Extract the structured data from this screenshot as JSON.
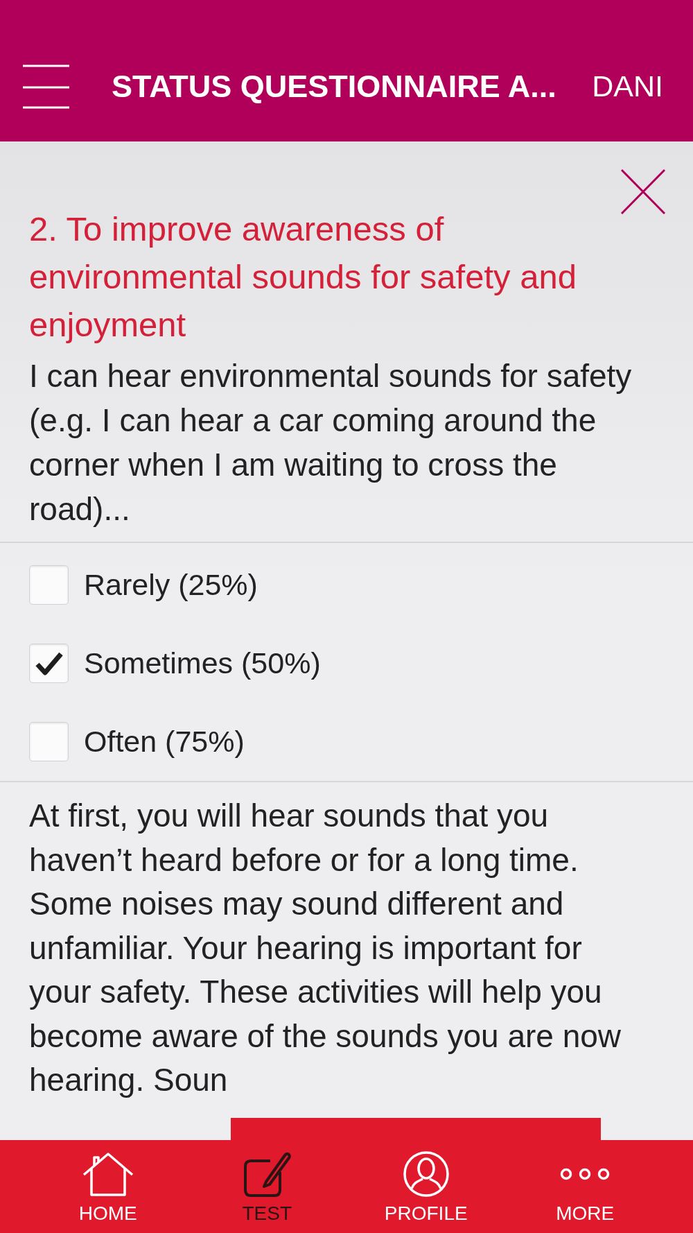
{
  "header": {
    "title": "STATUS QUESTIONNAIRE A...",
    "user": "DANI"
  },
  "question": {
    "heading": "2. To improve awareness of environmental sounds for safety and enjoyment",
    "prompt": "I can hear environmental sounds for safety (e.g. I can hear a car coming around the corner when I am waiting to cross the road)...",
    "options": [
      {
        "label": "Rarely (25%)",
        "checked": false
      },
      {
        "label": "Sometimes (50%)",
        "checked": true
      },
      {
        "label": "Often (75%)",
        "checked": false
      }
    ],
    "explanation": "At first, you will hear sounds that you haven’t heard before or for a long time. Some noises may sound different and unfamiliar. Your hearing is important for your safety. These activities will help you become aware of the sounds you are now hearing. Soun"
  },
  "bottom_nav": [
    {
      "label": "HOME",
      "selected": false
    },
    {
      "label": "TEST",
      "selected": true
    },
    {
      "label": "PROFILE",
      "selected": false
    },
    {
      "label": "MORE",
      "selected": false
    }
  ]
}
